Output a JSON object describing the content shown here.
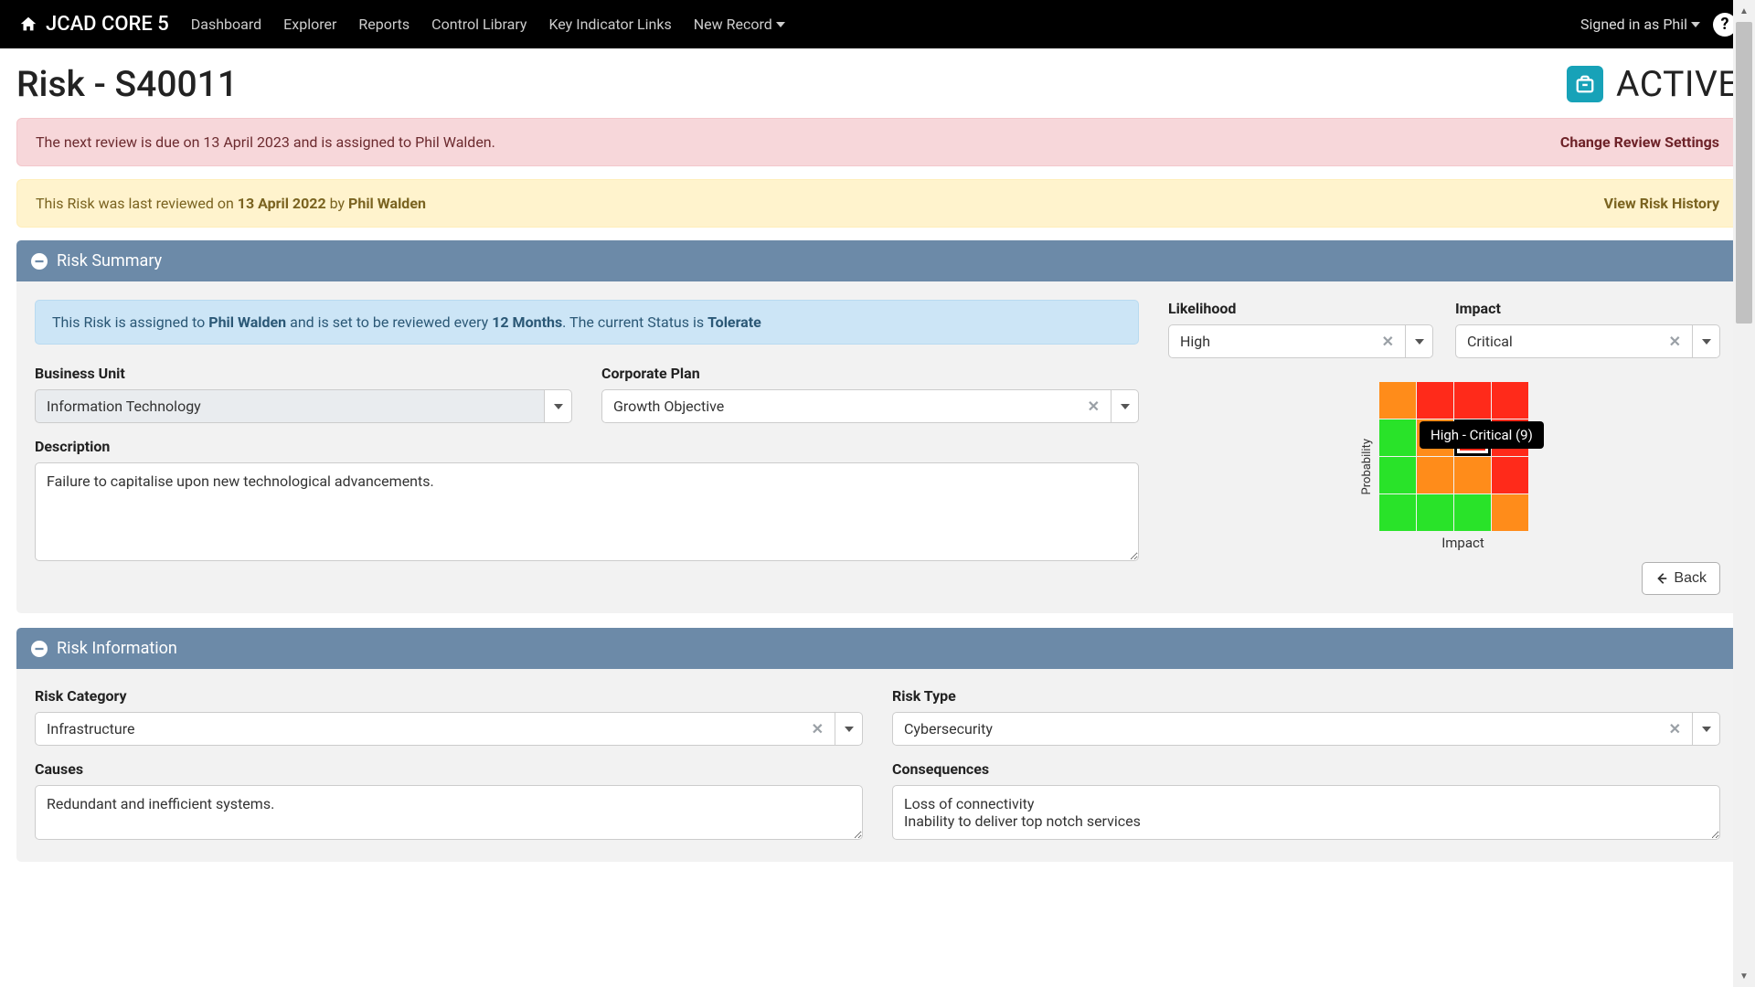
{
  "nav": {
    "brand": "JCAD CORE 5",
    "items": [
      "Dashboard",
      "Explorer",
      "Reports",
      "Control Library",
      "Key Indicator Links",
      "New Record"
    ],
    "signin_prefix": "Signed in as ",
    "signin_user": "Phil"
  },
  "header": {
    "title": "Risk - S40011",
    "status": "ACTIVE"
  },
  "alerts": {
    "review": {
      "text": "The next review is due on 13 April 2023 and is assigned to Phil Walden.",
      "link": "Change Review Settings"
    },
    "history": {
      "prefix": "This Risk was last reviewed on ",
      "date": "13 April 2022",
      "by": " by ",
      "user": "Phil Walden",
      "link": "View Risk History"
    }
  },
  "summary": {
    "title": "Risk Summary",
    "callout": {
      "p1": "This Risk is assigned to ",
      "user": "Phil Walden",
      "p2": " and is set to be reviewed every ",
      "period": "12 Months",
      "p3": ". The current Status is ",
      "status": "Tolerate"
    },
    "labels": {
      "bu": "Business Unit",
      "cp": "Corporate Plan",
      "desc": "Description",
      "likelihood": "Likelihood",
      "impact": "Impact"
    },
    "values": {
      "bu": "Information Technology",
      "cp": "Growth Objective",
      "desc": "Failure to capitalise upon new technological advancements.",
      "likelihood": "High",
      "impact": "Critical"
    },
    "heatmap": {
      "y_label": "Probability",
      "x_label": "Impact",
      "tooltip": "High - Critical (9)",
      "colors": [
        [
          "#ff8c1a",
          "#ff2a1a",
          "#ff2a1a",
          "#ff2a1a"
        ],
        [
          "#29e329",
          "#ff8c1a",
          "#ff2a1a",
          "#ff2a1a"
        ],
        [
          "#29e329",
          "#ff8c1a",
          "#ff8c1a",
          "#ff2a1a"
        ],
        [
          "#29e329",
          "#29e329",
          "#29e329",
          "#ff8c1a"
        ]
      ],
      "selected_row": 1,
      "selected_col": 2
    },
    "back_btn": "Back"
  },
  "info": {
    "title": "Risk Information",
    "labels": {
      "category": "Risk Category",
      "type": "Risk Type",
      "causes": "Causes",
      "consequences": "Consequences"
    },
    "values": {
      "category": "Infrastructure",
      "type": "Cybersecurity",
      "causes": "Redundant and inefficient systems.",
      "consequences": "Loss of connectivity\nInability to deliver top notch services"
    }
  }
}
